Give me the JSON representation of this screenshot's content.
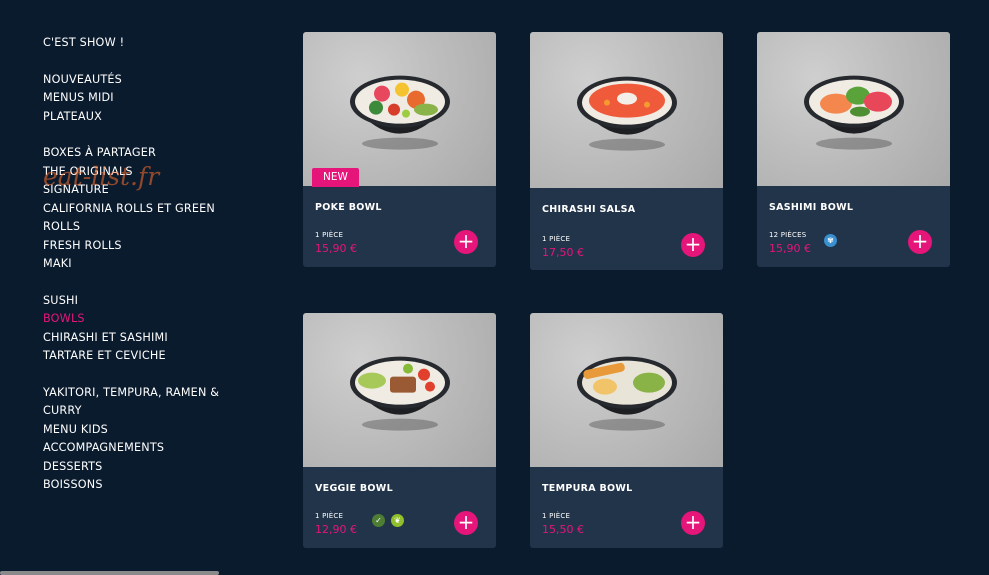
{
  "sidebar": {
    "groups": [
      {
        "items": [
          {
            "label": "C'EST SHOW !",
            "active": false
          }
        ]
      },
      {
        "items": [
          {
            "label": "NOUVEAUTÉS",
            "active": false
          },
          {
            "label": "MENUS MIDI",
            "active": false
          },
          {
            "label": "PLATEAUX",
            "active": false
          }
        ]
      },
      {
        "items": [
          {
            "label": "BOXES À PARTAGER",
            "active": false
          },
          {
            "label": "THE ORIGINALS",
            "active": false
          },
          {
            "label": "SIGNATURE",
            "active": false
          },
          {
            "label": "CALIFORNIA ROLLS ET GREEN ROLLS",
            "active": false
          },
          {
            "label": "FRESH ROLLS",
            "active": false
          },
          {
            "label": "MAKI",
            "active": false
          }
        ]
      },
      {
        "items": [
          {
            "label": "SUSHI",
            "active": false
          },
          {
            "label": "BOWLS",
            "active": true
          },
          {
            "label": "CHIRASHI ET SASHIMI",
            "active": false
          },
          {
            "label": "TARTARE ET CEVICHE",
            "active": false
          }
        ]
      },
      {
        "items": [
          {
            "label": "YAKITORI, TEMPURA, RAMEN & CURRY",
            "active": false
          },
          {
            "label": "MENU KIDS",
            "active": false
          },
          {
            "label": "ACCOMPAGNEMENTS",
            "active": false
          },
          {
            "label": "DESSERTS",
            "active": false
          },
          {
            "label": "BOISSONS",
            "active": false
          }
        ]
      }
    ]
  },
  "watermark": "eat-list.fr",
  "colors": {
    "background": "#0b1b2e",
    "card": "#22344a",
    "accent": "#e5157a"
  },
  "products": [
    {
      "name": "POKE BOWL",
      "pieces": "1 PIÈCE",
      "price": "15,90 €",
      "badge": "NEW",
      "diet_icons": [],
      "bowl": "poke",
      "add_icon": "plus-icon"
    },
    {
      "name": "CHIRASHI SALSA",
      "pieces": "1 PIÈCE",
      "price": "17,50 €",
      "badge": "",
      "diet_icons": [],
      "bowl": "chirashi",
      "add_icon": "plus-icon"
    },
    {
      "name": "SASHIMI BOWL",
      "pieces": "12 PIÈCES",
      "price": "15,90 €",
      "badge": "",
      "diet_icons": [
        "gluten-free-icon"
      ],
      "bowl": "sashimi",
      "add_icon": "plus-icon"
    },
    {
      "name": "VEGGIE BOWL",
      "pieces": "1 PIÈCE",
      "price": "12,90 €",
      "badge": "",
      "diet_icons": [
        "vegetarian-icon",
        "vegan-icon"
      ],
      "bowl": "veggie",
      "add_icon": "plus-icon"
    },
    {
      "name": "TEMPURA BOWL",
      "pieces": "1 PIÈCE",
      "price": "15,50 €",
      "badge": "",
      "diet_icons": [],
      "bowl": "tempura",
      "add_icon": "plus-icon"
    }
  ]
}
